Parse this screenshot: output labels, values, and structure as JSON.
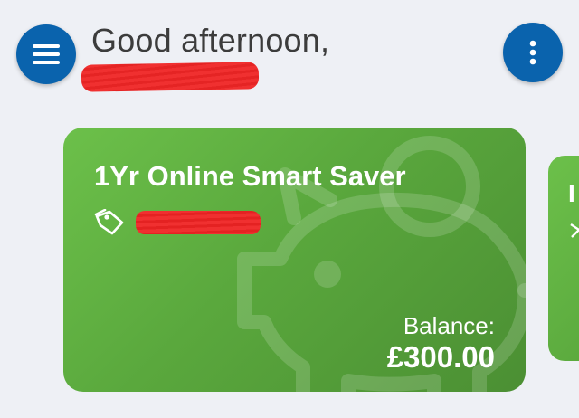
{
  "header": {
    "greeting": "Good afternoon,",
    "menu_icon": "hamburger-menu-icon",
    "more_icon": "vertical-dots-icon",
    "accent_color": "#0a63ad"
  },
  "accounts": [
    {
      "title": "1Yr Online Smart Saver",
      "balance_label": "Balance:",
      "balance": "£300.00",
      "tag_icon": "tag-icon",
      "background_icon": "piggy-bank-icon",
      "color": "#5aa83d"
    },
    {
      "title": "I",
      "tag_icon": "tag-icon",
      "color": "#5aa83d"
    }
  ]
}
